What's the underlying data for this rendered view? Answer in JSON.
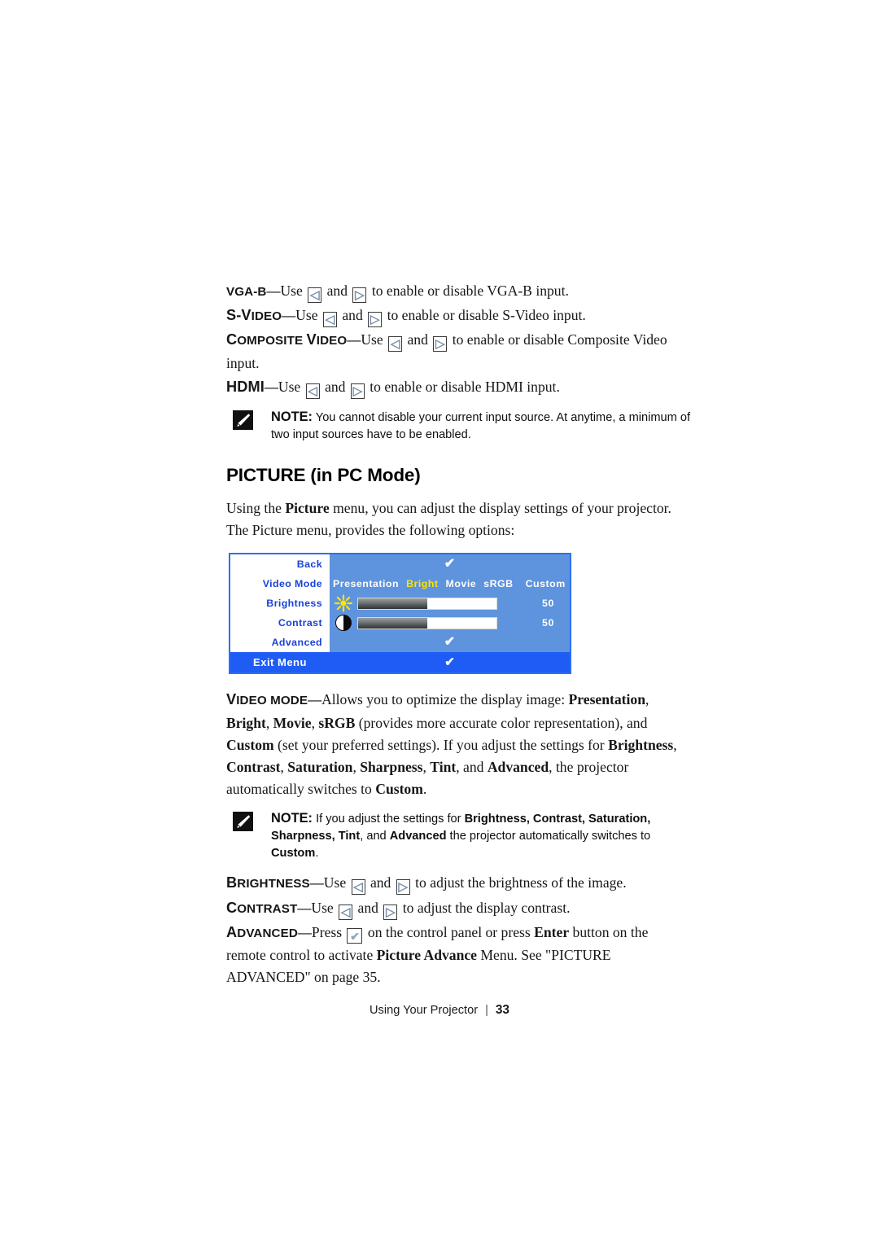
{
  "input_lines": [
    {
      "term": "VGA-B",
      "term_caps": "VGA-B",
      "dash": "—",
      "use": "Use",
      "and": "and",
      "tail": "to enable or disable VGA-B input."
    },
    {
      "term": "S-Video",
      "term_lead": "S-V",
      "term_rest": "IDEO",
      "dash": "—",
      "use": "Use",
      "and": "and",
      "tail": "to enable or disable S-Video input."
    },
    {
      "term": "Composite Video",
      "term_lead": "C",
      "term_rest": "OMPOSITE",
      "term_lead2": "V",
      "term_rest2": "IDEO",
      "dash": "—",
      "use": "Use",
      "and": "and",
      "tail": "to enable or disable Composite Video input."
    },
    {
      "term": "HDMI",
      "dash": "—",
      "use": "Use",
      "and": "and",
      "tail": "to enable or disable HDMI input."
    }
  ],
  "note1": {
    "label": "NOTE:",
    "text": "You cannot disable your current input source. At anytime, a minimum of two input sources have to be enabled.",
    "icon": "note-pencil-icon"
  },
  "section": {
    "title": "PICTURE (in PC Mode)",
    "intro_a": "Using the ",
    "intro_bold": "Picture",
    "intro_b": " menu, you can adjust the display settings of your projector. The Picture menu, provides the following options:"
  },
  "osd": {
    "rows": [
      {
        "label": "Back",
        "type": "check",
        "check": "✔"
      },
      {
        "label": "Video Mode",
        "type": "modes"
      },
      {
        "label": "Brightness",
        "type": "slider",
        "icon": "sun-icon",
        "value": "50",
        "fill_percent": 50
      },
      {
        "label": "Contrast",
        "type": "slider",
        "icon": "contrast-icon",
        "value": "50",
        "fill_percent": 50
      },
      {
        "label": "Advanced",
        "type": "check",
        "check": "✔"
      }
    ],
    "video_modes": [
      {
        "label": "Presentation",
        "selected": false
      },
      {
        "label": "Bright",
        "selected": true
      },
      {
        "label": "Movie",
        "selected": false
      },
      {
        "label": "sRGB",
        "selected": false
      },
      {
        "label": "Custom",
        "selected": false
      }
    ],
    "exit": {
      "label": "Exit Menu",
      "check": "✔"
    },
    "colors": {
      "border": "#2f6ef0",
      "body": "#5e93dd",
      "label_bg": "#ffffff",
      "label_text": "#1942d8",
      "exit_bar": "#1f5cf5",
      "selected_mode": "#ffe400"
    }
  },
  "video_mode_para": {
    "term_lead": "V",
    "term_rest": "IDEO MODE",
    "dash": "—",
    "t1": "Allows you to optimize the display image: ",
    "b1": "Presentation",
    "t2": ", ",
    "b2": "Bright",
    "t3": ", ",
    "b3": "Movie",
    "t4": ", ",
    "b4": "sRGB",
    "t5": " (provides more accurate color representation), and ",
    "b5": "Custom",
    "t6": " (set your preferred settings). If you adjust the settings for ",
    "b6": "Brightness",
    "t7": ", ",
    "b7": "Contrast",
    "t8": ", ",
    "b8": "Saturation",
    "t9": ", ",
    "b9": "Sharpness",
    "t10": ", ",
    "b10": "Tint",
    "t11": ", and ",
    "b11": "Advanced",
    "t12": ", the projector automatically switches to ",
    "b12": "Custom",
    "t13": "."
  },
  "note2": {
    "label": "NOTE:",
    "t1": "If you adjust the settings for ",
    "b1": "Brightness, Contrast, Saturation, Sharpness, Tint",
    "t2": ", and ",
    "b2": "Advanced",
    "t3": " the projector automatically switches to ",
    "b3": "Custom",
    "t4": ".",
    "icon": "note-pencil-icon"
  },
  "brightness_line": {
    "term_lead": "B",
    "term_rest": "RIGHTNESS",
    "dash": "—",
    "use": "Use",
    "and": "and",
    "tail": "to adjust the brightness of the image."
  },
  "contrast_line": {
    "term_lead": "C",
    "term_rest": "ONTRAST",
    "dash": "—",
    "use": "Use",
    "and": "and",
    "tail": "to adjust the display contrast."
  },
  "advanced_para": {
    "term_lead": "A",
    "term_rest": "DVANCED",
    "dash": "—",
    "t1": "Press",
    "t2": "on the control panel or press ",
    "b1": "Enter",
    "t3": " button on the remote control to activate ",
    "b2": "Picture Advance",
    "t4": " Menu. See \"PICTURE ADVANCED\" on page 35."
  },
  "keys": {
    "left": "◁",
    "right": "▷",
    "check": "✔"
  },
  "footer": {
    "title": "Using Your Projector",
    "separator": "|",
    "page": "33"
  }
}
